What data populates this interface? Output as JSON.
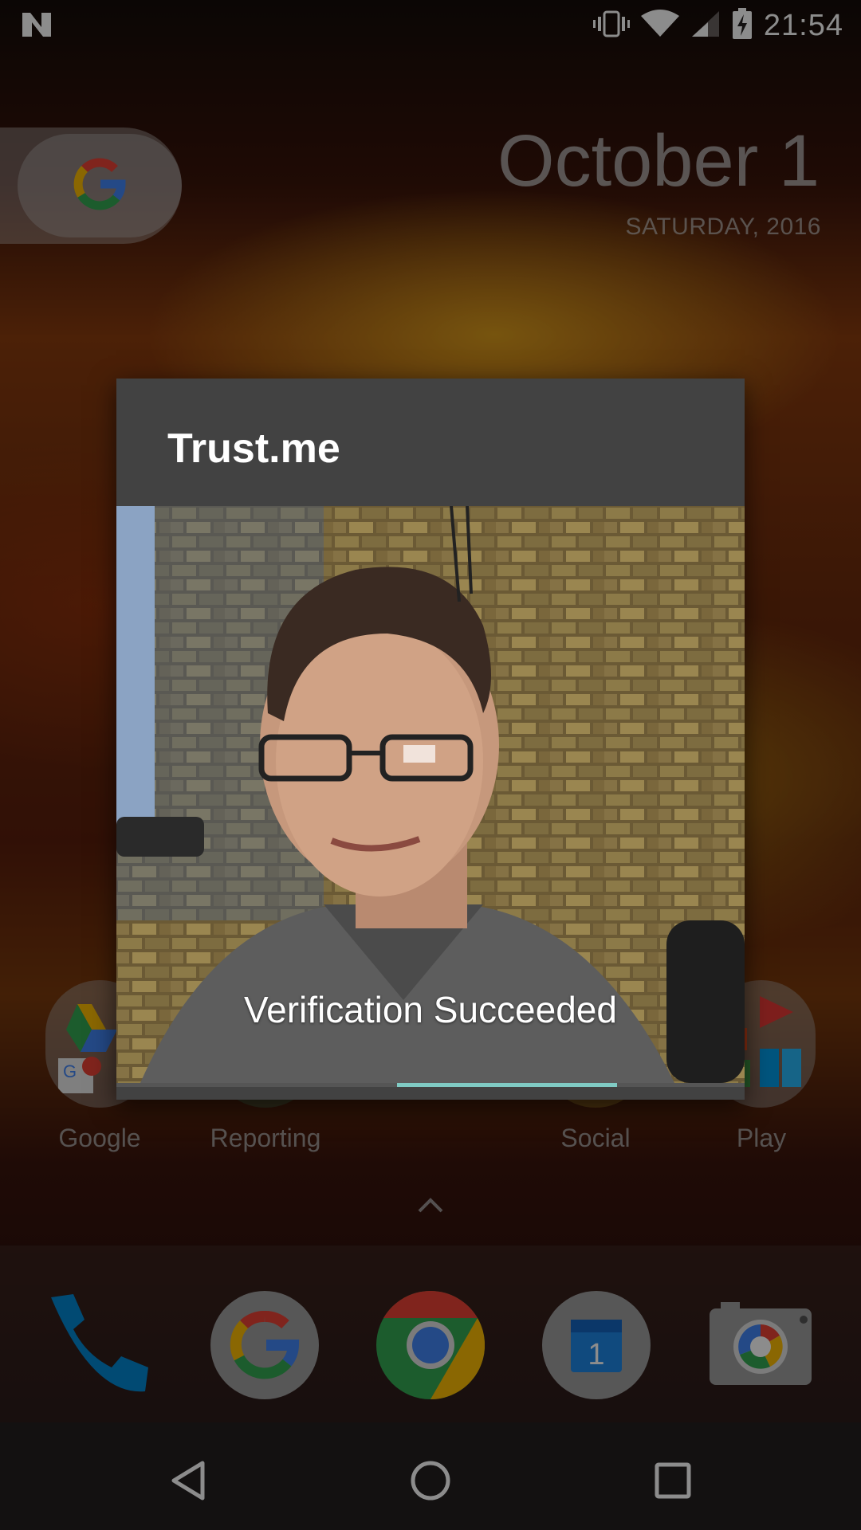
{
  "status_bar": {
    "time": "21:54"
  },
  "home": {
    "date": "October 1",
    "date_sub": "SATURDAY, 2016",
    "apps": [
      {
        "label": "Google"
      },
      {
        "label": "Reporting"
      },
      {
        "label": "Social"
      },
      {
        "label": "Play"
      }
    ],
    "dock": [
      "phone-icon",
      "google-app-icon",
      "chrome-icon",
      "calendar-icon",
      "camera-icon"
    ],
    "calendar_day": "1"
  },
  "dialog": {
    "title": "Trust.me",
    "result": "Verification Succeeded",
    "progress_fraction": 0.35,
    "accent": "#80cbc4"
  }
}
